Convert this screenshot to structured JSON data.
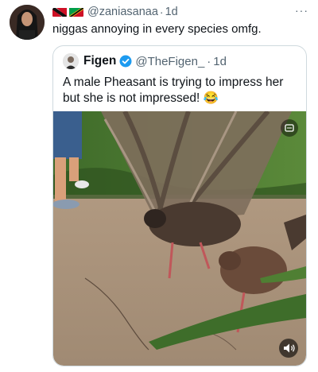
{
  "post": {
    "handle": "@zaniasanaa",
    "separator": "·",
    "time": "1d",
    "text": "niggas annoying in every species omfg.",
    "more_label": "···"
  },
  "quoted": {
    "name": "Figen",
    "handle": "@TheFigen_",
    "separator": "·",
    "time": "1d",
    "text": "A male Pheasant is trying to impress her but she is not impressed! 😂"
  },
  "icons": {
    "flags": [
      "flag-trinidad-and-tobago",
      "flag-saint-kitts-and-nevis"
    ],
    "verified": "verified-badge-icon",
    "gif": "gif-icon",
    "sound": "speaker-icon"
  },
  "colors": {
    "text": "#0f1419",
    "secondary": "#536471",
    "verified": "#1d9bf0",
    "border": "#cfd9de"
  }
}
